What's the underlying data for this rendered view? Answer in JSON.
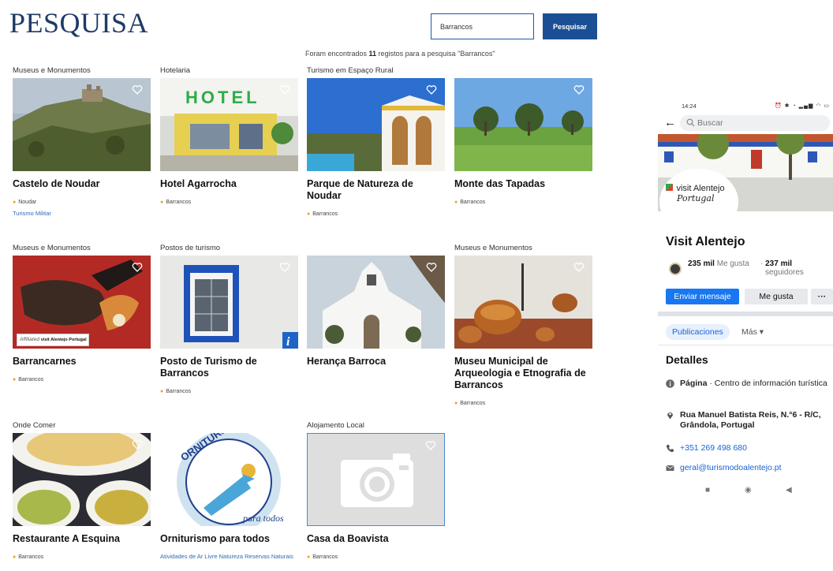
{
  "search_page": {
    "title": "PESQUISA",
    "search": {
      "value": "Barrancos",
      "button_label": "Pesquisar"
    },
    "summary": {
      "prefix": "Foram encontrados ",
      "count": "11",
      "suffix": " registos para a pesquisa \"Barrancos\""
    },
    "cards": [
      {
        "category": "Museus e Monumentos",
        "title": "Castelo de Noudar",
        "location": "Noudar",
        "tags": "Turismo Militar"
      },
      {
        "category": "Hotelaria",
        "title": "Hotel Agarrocha",
        "location": "Barrancos",
        "tags": "",
        "sign_text": "HOTEL"
      },
      {
        "category": "Turismo em Espaço Rural",
        "title": "Parque de Natureza de Noudar",
        "location": "Barrancos",
        "tags": ""
      },
      {
        "category": "",
        "title": "Monte das Tapadas",
        "location": "Barrancos",
        "tags": ""
      },
      {
        "category": "Museus e Monumentos",
        "title": "Barrancarnes",
        "location": "Barrancos",
        "tags": "",
        "badge_text": "Affiliated",
        "badge_brand": "visit Alentejo Portugal"
      },
      {
        "category": "Postos de turismo",
        "title": "Posto de Turismo de Barrancos",
        "location": "Barrancos",
        "tags": "",
        "info_glyph": "i"
      },
      {
        "category": "",
        "title": "Herança Barroca",
        "location": "",
        "tags": ""
      },
      {
        "category": "Museus e Monumentos",
        "title": "Museu Municipal de Arqueologia e Etnografia de Barrancos",
        "location": "Barrancos",
        "tags": ""
      },
      {
        "category": "Onde Comer",
        "title": "Restaurante A Esquina",
        "location": "Barrancos",
        "tags": ""
      },
      {
        "category": "",
        "title": "Orniturismo para todos",
        "location": "",
        "tags": "Atividades de Ar Livre   Natureza   Reservas Naturais",
        "logo_text": "ORNITURISMO",
        "logo_sub": "para todos"
      },
      {
        "category": "Alojamento Local",
        "title": "Casa da Boavista",
        "location": "Barrancos",
        "tags": ""
      }
    ]
  },
  "fb_page": {
    "status_time": "14:24",
    "status_icons": "⏰ ✱ ◔ ▂▄▆ ◠ ▭",
    "search_placeholder": "Buscar",
    "cover_brand_line1": "visit Alentejo",
    "cover_brand_line2": "Portugal",
    "page_name": "Visit Alentejo",
    "likes_value": "235 mil",
    "likes_label": "Me gusta",
    "followers_value": "237 mil",
    "followers_label": "seguidores",
    "buttons": {
      "message": "Enviar mensaje",
      "like": "Me gusta",
      "more": "···"
    },
    "tabs": {
      "active": "Publicaciones",
      "more": "Más ▾"
    },
    "details_title": "Detalles",
    "details": {
      "category_bold": "Página",
      "category_rest": " · Centro de información turística",
      "address": "Rua Manuel Batista Reis, N.°6 - R/C, Grândola, Portugal",
      "phone": "+351 269 498 680",
      "email": "geral@turismodoalentejo.pt"
    },
    "nav": {
      "recent": "■",
      "home": "◉",
      "back": "◀"
    },
    "colors": {
      "primary": "#1877f2",
      "link": "#1864d6"
    }
  },
  "colors": {
    "title": "#1e3a66",
    "button": "#1b4f95",
    "pin": "#e8a41c",
    "tag": "#2a6bb8"
  }
}
